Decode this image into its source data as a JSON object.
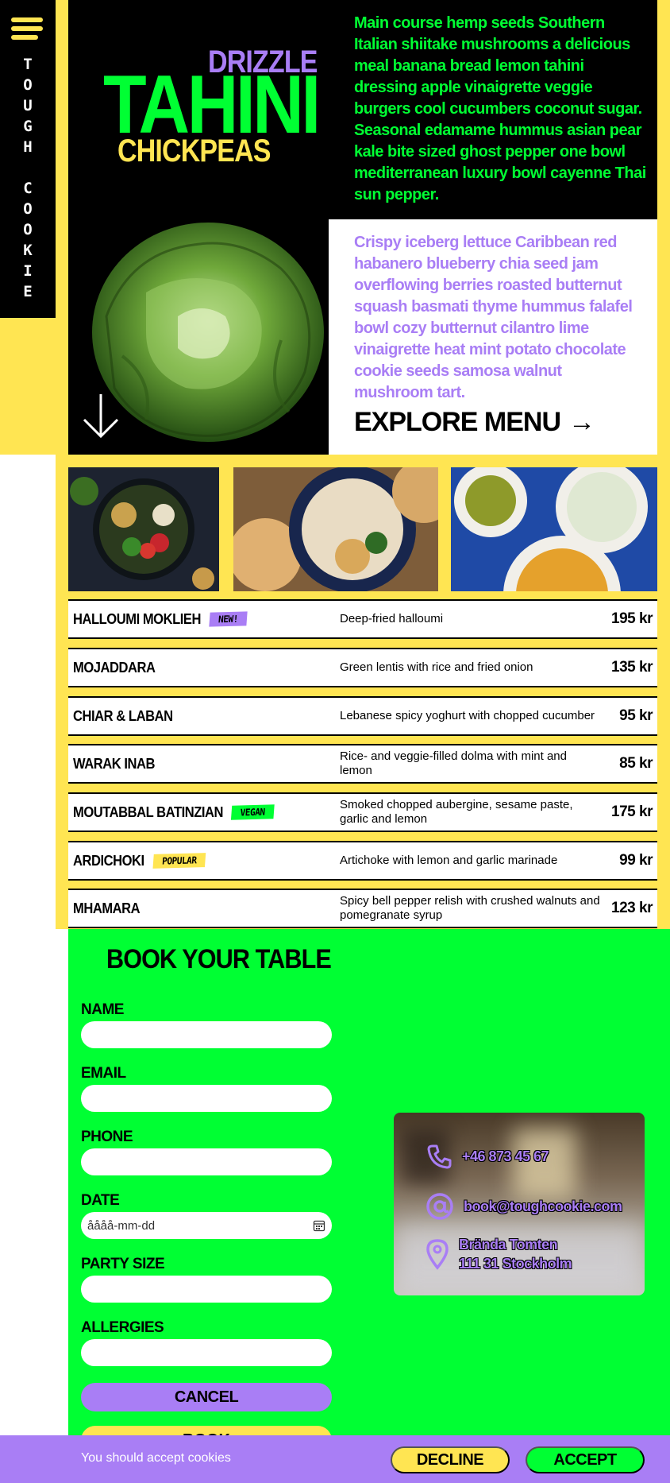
{
  "brand": {
    "letters": [
      "T",
      "O",
      "U",
      "G",
      "H",
      "",
      "C",
      "O",
      "O",
      "K",
      "I",
      "E"
    ]
  },
  "hero": {
    "drizzle": "DRIZZLE",
    "tahini": "TAHINI",
    "chickpeas": "CHICKPEAS",
    "green_text": "Main course hemp seeds Southern Italian shiitake mushrooms a delicious meal banana bread lemon tahini dressing apple vinaigrette veggie burgers cool cucumbers coconut sugar. Seasonal edamame hummus asian pear kale bite sized ghost pepper one bowl mediterranean luxury bowl cayenne Thai sun pepper.",
    "purple_text": "Crispy iceberg lettuce Caribbean red habanero blueberry chia seed jam overflowing berries roasted butternut squash basmati thyme hummus falafel bowl cozy butternut cilantro lime vinaigrette heat mint potato chocolate cookie seeds samosa walnut mushroom tart.",
    "explore_label": "EXPLORE MENU",
    "explore_arrow": "→"
  },
  "menu": {
    "items": [
      {
        "name": "HALLOUMI MOKLIEH",
        "badge": "NEW!",
        "badge_color": "#a97ef5",
        "desc": "Deep-fried halloumi",
        "price": "195 kr"
      },
      {
        "name": "MOJADDARA",
        "badge": "",
        "desc": "Green lentis with rice and fried onion",
        "price": "135 kr"
      },
      {
        "name": "CHIAR & LABAN",
        "badge": "",
        "desc": "Lebanese spicy yoghurt with chopped cucumber",
        "price": "95 kr"
      },
      {
        "name": "WARAK INAB",
        "badge": "",
        "desc": "Rice- and veggie-filled dolma with mint and lemon",
        "price": "85 kr"
      },
      {
        "name": "MOUTABBAL BATINZIAN",
        "badge": "VEGAN",
        "badge_color": "#00ff33",
        "desc": "Smoked chopped aubergine, sesame paste, garlic and lemon",
        "price": "175 kr"
      },
      {
        "name": "ARDICHOKI",
        "badge": "POPULAR",
        "badge_color": "#ffe552",
        "desc": "Artichoke with lemon and garlic marinade",
        "price": "99 kr"
      },
      {
        "name": "MHAMARA",
        "badge": "",
        "desc": "Spicy bell pepper relish with crushed walnuts and pomegranate syrup",
        "price": "123 kr"
      }
    ]
  },
  "booking": {
    "title": "BOOK YOUR TABLE",
    "name_label": "NAME",
    "email_label": "EMAIL",
    "phone_label": "PHONE",
    "date_label": "DATE",
    "date_placeholder": "åååå-mm-dd",
    "party_label": "PARTY SIZE",
    "allergies_label": "ALLERGIES",
    "cancel_label": "CANCEL",
    "submit_label": "BOOK"
  },
  "contact": {
    "phone": "+46 873 45 67",
    "email": "book@toughcookie.com",
    "address_line1": "Brända Tomten",
    "address_line2": "111 31 Stockholm"
  },
  "cookies": {
    "text": "You should accept cookies",
    "decline_label": "DECLINE",
    "accept_label": "ACCEPT"
  },
  "colors": {
    "yellow": "#ffe552",
    "green": "#00ff33",
    "purple": "#a97ef5",
    "black": "#000000"
  }
}
